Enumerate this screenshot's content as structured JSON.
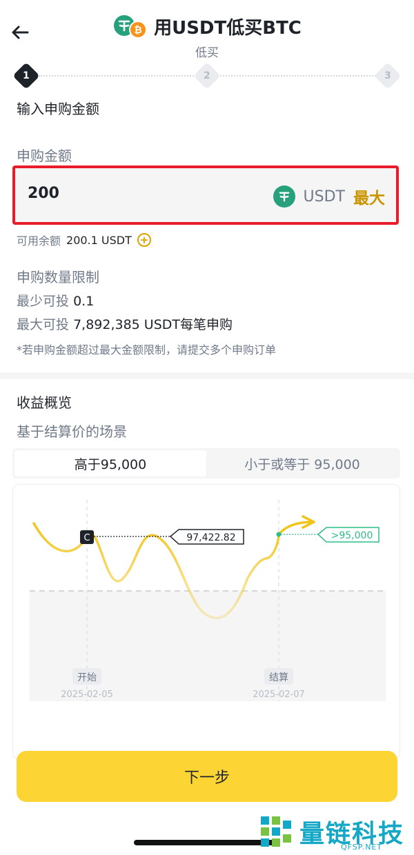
{
  "header": {
    "title": "用USDT低买BTC",
    "subtitle": "低买"
  },
  "stepper": {
    "steps": [
      "1",
      "2",
      "3"
    ],
    "active_index": 0
  },
  "section": {
    "input_title": "输入申购金额",
    "amount_label": "申购金额"
  },
  "amount": {
    "value": "200",
    "currency": "USDT",
    "max_label": "最大"
  },
  "balance": {
    "label": "可用余额",
    "value": "200.1 USDT"
  },
  "limits": {
    "title": "申购数量限制",
    "min_label": "最少可投",
    "min_value": "0.1",
    "max_label": "最大可投",
    "max_value": "7,892,385 USDT每笔申购",
    "note": "*若申购金额超过最大金额限制，请提交多个申购订单"
  },
  "yield": {
    "title": "收益概览",
    "subtitle": "基于结算价的场景"
  },
  "tabs": [
    {
      "label": "高于95,000",
      "active": true
    },
    {
      "label": "小于或等于 95,000",
      "active": false
    }
  ],
  "chart": {
    "marker_label": "C",
    "price_label": "97,422.82",
    "target_label": ">95,000",
    "start_label": "开始",
    "start_date": "2025-02-05",
    "end_label": "结算",
    "end_date": "2025-02-07",
    "line_color": "#f0c419",
    "target_color": "#2ebd85"
  },
  "actions": {
    "next_label": "下一步"
  },
  "watermark": {
    "text": "量链科技",
    "sub": "QFSP.NET"
  },
  "colors": {
    "accent": "#fcd535",
    "max_text": "#c99400",
    "highlight_border": "#e81c2a",
    "usdt": "#26a17b",
    "btc": "#f7931a"
  }
}
